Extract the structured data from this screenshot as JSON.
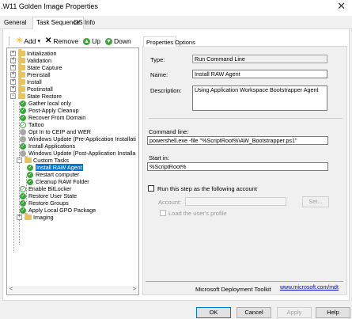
{
  "window": {
    "title": ".W11 Golden Image Properties",
    "close_glyph": "✕"
  },
  "tabs": [
    {
      "label": "General"
    },
    {
      "label": "Task Sequence"
    },
    {
      "label": "OS Info"
    }
  ],
  "toolbar": {
    "add_label": "Add",
    "add_arrow": "▾",
    "remove_label": "Remove",
    "up_label": "Up",
    "down_label": "Down"
  },
  "tree": {
    "items": [
      {
        "label": "Initialization",
        "icon": "folder-icon",
        "expander": "+"
      },
      {
        "label": "Validation",
        "icon": "folder-icon",
        "expander": "+"
      },
      {
        "label": "State Capture",
        "icon": "folder-icon",
        "expander": "+"
      },
      {
        "label": "Preinstall",
        "icon": "folder-icon",
        "expander": "+"
      },
      {
        "label": "Install",
        "icon": "folder-icon",
        "expander": "+"
      },
      {
        "label": "Postinstall",
        "icon": "folder-icon",
        "expander": "+"
      },
      {
        "label": "State Restore",
        "icon": "folder-icon",
        "expander": "−"
      },
      {
        "label": "Gather local only",
        "icon": "check-icon"
      },
      {
        "label": "Post-Apply Cleanup",
        "icon": "check-icon"
      },
      {
        "label": "Recover From Domain",
        "icon": "check-icon"
      },
      {
        "label": "Tattoo",
        "icon": "check-outline-icon"
      },
      {
        "label": "Opt In to CEIP and WER",
        "icon": "disabled-icon"
      },
      {
        "label": "Windows Update (Pre-Application Installati",
        "icon": "disabled-icon"
      },
      {
        "label": "Install Applications",
        "icon": "check-icon"
      },
      {
        "label": "Windows Update (Post-Application Installa",
        "icon": "disabled-icon"
      },
      {
        "label": "Custom Tasks",
        "icon": "folder-icon",
        "expander": "−"
      },
      {
        "label": "Install RAW Agent",
        "icon": "check-icon",
        "selected": true
      },
      {
        "label": "Restart computer",
        "icon": "check-icon"
      },
      {
        "label": "Cleanup RAW Folder",
        "icon": "check-icon"
      },
      {
        "label": "Enable BitLocker",
        "icon": "check-outline-icon"
      },
      {
        "label": "Restore User State",
        "icon": "check-icon"
      },
      {
        "label": "Restore Groups",
        "icon": "check-icon"
      },
      {
        "label": "Apply Local GPO Package",
        "icon": "check-icon"
      },
      {
        "label": "Imaging",
        "icon": "folder-icon",
        "expander": "+"
      }
    ],
    "scroll_left": "<",
    "scroll_right": ">"
  },
  "props_tabs": [
    {
      "label": "Properties"
    },
    {
      "label": "Options"
    }
  ],
  "props": {
    "type_label": "Type:",
    "type_value": "Run Command Line",
    "name_label": "Name:",
    "name_value": "Install RAW Agent",
    "description_label": "Description:",
    "description_value": "Using Application Workspace Bootstrapper Agent",
    "command_label": "Command line:",
    "command_value": "powershell.exe -file \"%ScriptRoot%\\AW_Bootstrapper.ps1\"",
    "startin_label": "Start in:",
    "startin_value": "%ScriptRoot%",
    "runas_label": "Run this step as the following account",
    "account_label": "Account:",
    "account_value": "",
    "set_label": "Set...",
    "loadprofile_label": "Load the user's profile",
    "footer_text": "Microsoft Deployment Toolkit",
    "footer_link": "www.microsoft.com/mdt"
  },
  "buttons": {
    "ok": "OK",
    "cancel": "Cancel",
    "apply": "Apply",
    "help": "Help"
  },
  "colors": {
    "selection": "#0078d7",
    "check_green": "#3aa63a",
    "folder_yellow": "#e8c35a"
  }
}
